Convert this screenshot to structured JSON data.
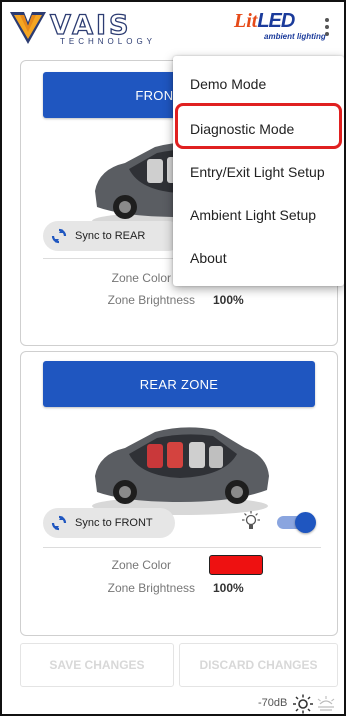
{
  "brand": {
    "vais_wordmark": "VAIS",
    "vais_tagline": "TECHNOLOGY",
    "litled_lit": "Lit",
    "litled_led": "LED",
    "litled_tagline": "ambient lighting"
  },
  "menu": {
    "items": [
      "Demo Mode",
      "Diagnostic Mode",
      "Entry/Exit Light Setup",
      "Ambient Light Setup",
      "About"
    ],
    "highlighted_index": 1
  },
  "front_zone": {
    "title": "FRONT ZONE",
    "sync_label": "Sync to REAR",
    "color_label": "Zone Color",
    "color": "#ee1111",
    "brightness_label": "Zone Brightness",
    "brightness_value": "100%"
  },
  "rear_zone": {
    "title": "REAR ZONE",
    "sync_label": "Sync to FRONT",
    "color_label": "Zone Color",
    "color": "#ee1111",
    "brightness_label": "Zone Brightness",
    "brightness_value": "100%",
    "light_enabled": true
  },
  "actions": {
    "save_label": "SAVE CHANGES",
    "discard_label": "DISCARD CHANGES"
  },
  "status": {
    "signal": "-70dB"
  },
  "colors": {
    "primary": "#1f56c0",
    "highlight": "#e02020",
    "zone_red": "#ee1111"
  }
}
